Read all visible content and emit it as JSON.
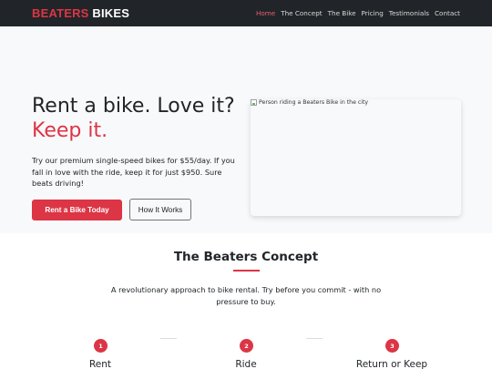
{
  "nav": {
    "brand_part1": "BEATERS",
    "brand_part2": "BIKES",
    "links": [
      "Home",
      "The Concept",
      "The Bike",
      "Pricing",
      "Testimonials",
      "Contact"
    ]
  },
  "hero": {
    "title_line1": "Rent a bike. Love it?",
    "title_line2": "Keep it.",
    "description": "Try our premium single-speed bikes for $55/day. If you fall in love with the ride, keep it for just $950. Sure beats driving!",
    "primary_button": "Rent a Bike Today",
    "secondary_button": "How It Works",
    "image_alt": "Person riding a Beaters Bike in the city"
  },
  "concept": {
    "title": "The Beaters Concept",
    "description": "A revolutionary approach to bike rental. Try before you commit - with no pressure to buy.",
    "steps": [
      {
        "number": "1",
        "label": "Rent"
      },
      {
        "number": "2",
        "label": "Ride"
      },
      {
        "number": "3",
        "label": "Return or Keep"
      }
    ]
  },
  "colors": {
    "accent": "#dc3545",
    "navbar": "#212529",
    "hero_bg": "#f8f9fa"
  }
}
